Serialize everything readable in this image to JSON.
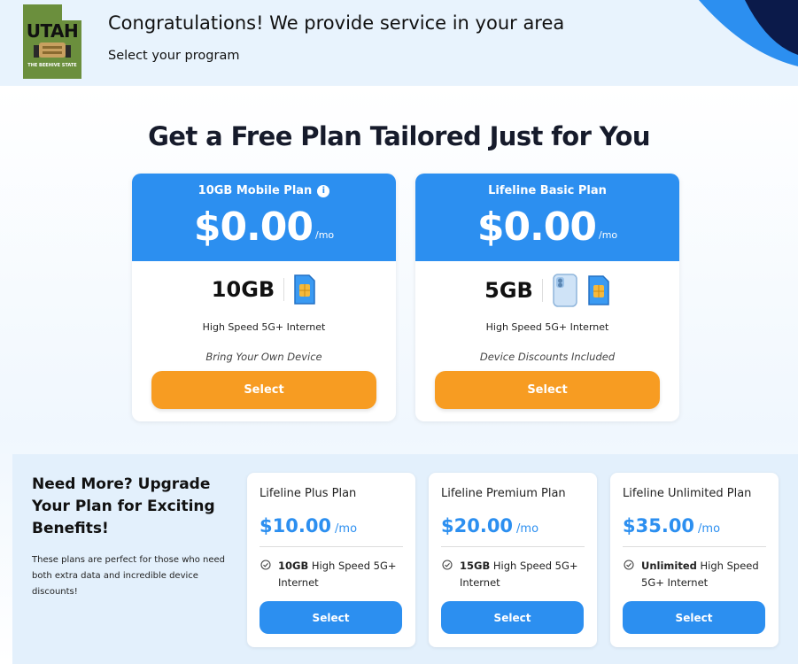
{
  "header": {
    "title": "Congratulations! We provide service in your area",
    "subtitle": "Select your program",
    "logo": {
      "word": "UTAH",
      "tagline": "THE BEEHIVE STATE"
    }
  },
  "hero": {
    "title": "Get a Free Plan Tailored Just for You"
  },
  "plans": [
    {
      "name": "10GB Mobile Plan",
      "has_info_icon": true,
      "price": "$0.00",
      "period": "/mo",
      "data_amount": "10GB",
      "feature": "High Speed 5G+ Internet",
      "note": "Bring Your Own Device",
      "button_label": "Select"
    },
    {
      "name": "Lifeline Basic Plan",
      "has_info_icon": false,
      "price": "$0.00",
      "period": "/mo",
      "data_amount": "5GB",
      "feature": "High Speed 5G+ Internet",
      "note": "Device Discounts Included",
      "button_label": "Select"
    }
  ],
  "upgrade": {
    "title": "Need More? Upgrade Your Plan for Exciting Benefits!",
    "description": "These plans are perfect for those who need both extra data and incredible device discounts!",
    "plans": [
      {
        "name": "Lifeline Plus Plan",
        "price": "$10.00",
        "period": "/mo",
        "feature_bold": "10GB",
        "feature_rest": " High Speed 5G+ Internet",
        "button_label": "Select"
      },
      {
        "name": "Lifeline Premium Plan",
        "price": "$20.00",
        "period": "/mo",
        "feature_bold": "15GB",
        "feature_rest": " High Speed 5G+ Internet",
        "button_label": "Select"
      },
      {
        "name": "Lifeline Unlimited Plan",
        "price": "$35.00",
        "period": "/mo",
        "feature_bold": "Unlimited",
        "feature_rest": " High Speed 5G+ Internet",
        "button_label": "Select"
      }
    ]
  },
  "colors": {
    "primary_blue": "#2c8ff0",
    "accent_orange": "#f79c22",
    "header_bg": "#e8f3fd",
    "upgrade_bg": "#e3f0fc",
    "logo_green": "#6b8f3d",
    "deco_navy": "#0b1a4a"
  },
  "icons": {
    "info": "info-icon",
    "sim": "sim-card-icon",
    "phone": "phone-icon",
    "check": "check-badge-icon"
  }
}
